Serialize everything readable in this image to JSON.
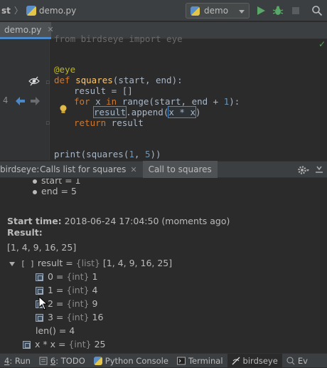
{
  "toolbar": {
    "breadcrumb_tail": "st",
    "file_name": "demo.py",
    "run_config": "demo"
  },
  "editor_tab": {
    "label": "demo.py"
  },
  "editor": {
    "line0": "from birdseye import eye",
    "decorator": "@eye",
    "def_kw": "def",
    "fn_name": "squares",
    "def_rest": "(start, end):",
    "l_result": "result = []",
    "for_kw": "for",
    "for_mid": " x ",
    "in_kw": "in",
    "for_range": " range(start, end + ",
    "for_num": "1",
    "for_end": "):",
    "append_target": "result",
    "append_mid": ".append(",
    "append_arg": "x * x",
    "append_end": ")",
    "return_kw": "return",
    "return_rest": " result",
    "print_pre": "print(squares(",
    "print_n1": "1",
    "print_mid": ", ",
    "print_n2": "5",
    "print_end": "))",
    "gutter_line_number": "4"
  },
  "panel": {
    "label": "birdseye:",
    "tabs": [
      {
        "label": "Calls list for squares"
      },
      {
        "label": "Call to squares"
      }
    ]
  },
  "call": {
    "arg_start": "start = 1",
    "arg_end": "end = 5",
    "start_time_label": "Start time:",
    "start_time_value": "2018-06-24 17:04:50 (moments ago)",
    "result_label": "Result:",
    "result_value": "[1, 4, 9, 16, 25]",
    "tree_root_name": "result = ",
    "tree_root_type": "{list}",
    "tree_root_value": " [1, 4, 9, 16, 25]",
    "items": [
      {
        "name": "0 = ",
        "type": "{int}",
        "value": " 1"
      },
      {
        "name": "1 = ",
        "type": "{int}",
        "value": " 4"
      },
      {
        "name": "2 = ",
        "type": "{int}",
        "value": " 9"
      },
      {
        "name": "3 = ",
        "type": "{int}",
        "value": " 16"
      }
    ],
    "len_row": "len() = 4",
    "expr_name": "x * x = ",
    "expr_type": "{int}",
    "expr_value": " 25"
  },
  "statusbar": {
    "run_num": "4",
    "run_label": ": Run",
    "todo_num": "6",
    "todo_label": ": TODO",
    "python_console": "Python Console",
    "terminal": "Terminal",
    "birdseye": "birdseye",
    "event_log": "Ev"
  }
}
